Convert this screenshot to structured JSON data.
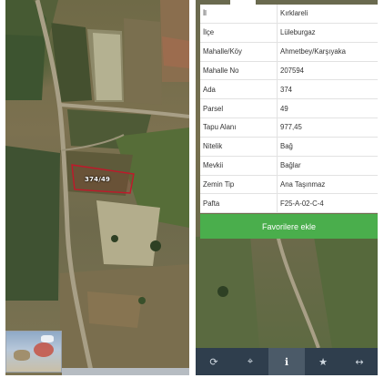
{
  "map": {
    "parcel_label": "374/49"
  },
  "parcel_info": {
    "rows": [
      {
        "key": "İl",
        "value": "Kırklareli"
      },
      {
        "key": "İlçe",
        "value": "Lüleburgaz"
      },
      {
        "key": "Mahalle/Köy",
        "value": "Ahmetbey/Karşıyaka"
      },
      {
        "key": "Mahalle No",
        "value": "207594"
      },
      {
        "key": "Ada",
        "value": "374"
      },
      {
        "key": "Parsel",
        "value": "49"
      },
      {
        "key": "Tapu Alanı",
        "value": "977,45"
      },
      {
        "key": "Nitelik",
        "value": "Bağ"
      },
      {
        "key": "Mevkii",
        "value": "Bağlar"
      },
      {
        "key": "Zemin Tip",
        "value": "Ana Taşınmaz"
      },
      {
        "key": "Pafta",
        "value": "F25-A-02-C-4"
      }
    ],
    "favorite_button": "Favorilere ekle"
  },
  "toolbar": {
    "items": [
      {
        "icon": "refresh-icon",
        "glyph": "⟳"
      },
      {
        "icon": "crosshair-icon",
        "glyph": "⌖"
      },
      {
        "icon": "info-icon",
        "glyph": "ℹ"
      },
      {
        "icon": "star-icon",
        "glyph": "★"
      },
      {
        "icon": "measure-icon",
        "glyph": "↔"
      }
    ],
    "active_index": 2
  },
  "colors": {
    "parcel_outline": "#c0182a",
    "favorite_button": "#4aae4c",
    "toolbar_bg": "#2f3e4d",
    "toolbar_active": "#4b5a68"
  }
}
